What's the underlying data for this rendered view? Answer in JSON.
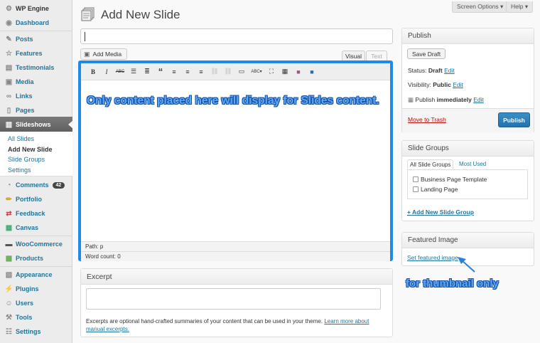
{
  "sidebar": {
    "items": [
      {
        "label": "WP Engine",
        "icon": "wp-engine-icon"
      },
      {
        "label": "Dashboard",
        "icon": "dashboard-icon"
      },
      {
        "label": "Posts",
        "icon": "pin-icon"
      },
      {
        "label": "Features",
        "icon": "star-icon"
      },
      {
        "label": "Testimonials",
        "icon": "book-icon"
      },
      {
        "label": "Media",
        "icon": "media-icon"
      },
      {
        "label": "Links",
        "icon": "link-icon"
      },
      {
        "label": "Pages",
        "icon": "page-icon"
      },
      {
        "label": "Slideshows",
        "icon": "slideshow-icon"
      },
      {
        "label": "Comments",
        "icon": "comment-icon",
        "badge": "42"
      },
      {
        "label": "Portfolio",
        "icon": "pencil-icon"
      },
      {
        "label": "Feedback",
        "icon": "feedback-icon"
      },
      {
        "label": "Canvas",
        "icon": "canvas-icon"
      },
      {
        "label": "WooCommerce",
        "icon": "woocommerce-icon"
      },
      {
        "label": "Products",
        "icon": "products-icon"
      },
      {
        "label": "Appearance",
        "icon": "appearance-icon"
      },
      {
        "label": "Plugins",
        "icon": "plugin-icon"
      },
      {
        "label": "Users",
        "icon": "users-icon"
      },
      {
        "label": "Tools",
        "icon": "tools-icon"
      },
      {
        "label": "Settings",
        "icon": "settings-icon"
      }
    ],
    "submenu": [
      "All Slides",
      "Add New Slide",
      "Slide Groups",
      "Settings"
    ]
  },
  "top": {
    "screen_options": "Screen Options ▾",
    "help": "Help ▾"
  },
  "page_title": "Add New Slide",
  "editor": {
    "add_media": "Add Media",
    "tab_visual": "Visual",
    "tab_text": "Text",
    "callout": "Only content placed here will display for Slides content.",
    "path": "Path: p",
    "word_count": "Word count: 0"
  },
  "excerpt": {
    "title": "Excerpt",
    "help_text": "Excerpts are optional hand-crafted summaries of your content that can be used in your theme.",
    "learn_more": "Learn more about manual excerpts."
  },
  "publish": {
    "title": "Publish",
    "save_draft": "Save Draft",
    "status_label": "Status:",
    "status_value": "Draft",
    "visibility_label": "Visibility:",
    "visibility_value": "Public",
    "publish_label": "Publish",
    "publish_value": "immediately",
    "edit": "Edit",
    "trash": "Move to Trash",
    "publish_button": "Publish"
  },
  "slide_groups": {
    "title": "Slide Groups",
    "tab_all": "All Slide Groups",
    "tab_most": "Most Used",
    "options": [
      "Business Page Template",
      "Landing Page"
    ],
    "add_new": "+ Add New Slide Group"
  },
  "featured": {
    "title": "Featured Image",
    "link": "Set featured image",
    "note": "for thumbnail only"
  },
  "colors": {
    "accent": "#1e8be6",
    "link": "#21759b",
    "publish_button": "#2e7bb5"
  }
}
